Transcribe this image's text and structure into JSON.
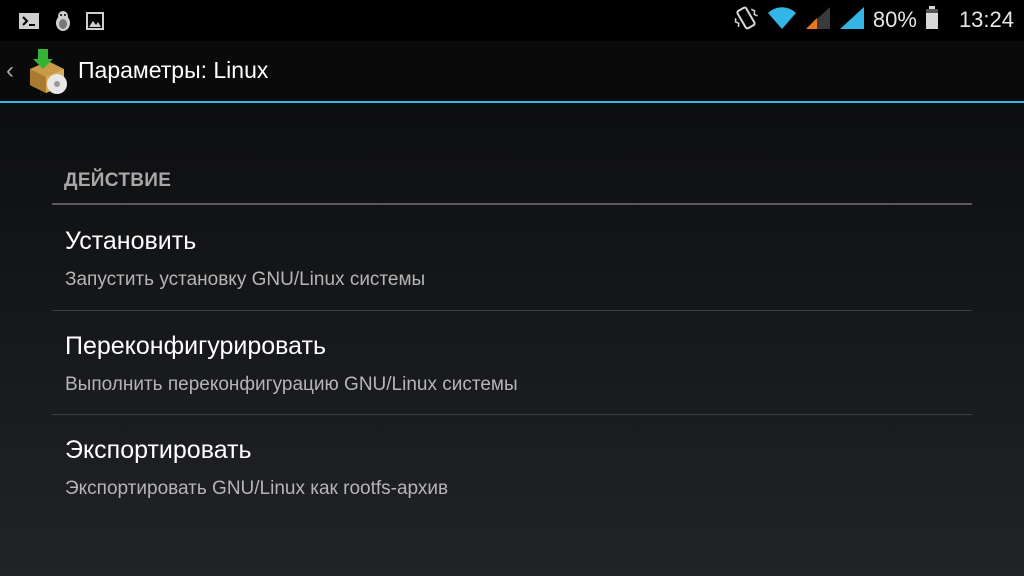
{
  "status_bar": {
    "battery_percent": "80%",
    "time": "13:24",
    "icons_left": [
      "terminal-icon",
      "linux-penguin-icon",
      "image-icon"
    ],
    "icons_right": [
      "vibrate-icon",
      "wifi-icon",
      "signal-sim1-icon",
      "signal-sim2-icon",
      "battery-icon"
    ]
  },
  "action_bar": {
    "title": "Параметры: Linux"
  },
  "section": {
    "header": "ДЕЙСТВИЕ"
  },
  "preferences": [
    {
      "title": "Установить",
      "summary": "Запустить установку GNU/Linux системы"
    },
    {
      "title": "Переконфигурировать",
      "summary": "Выполнить переконфигурацию GNU/Linux системы"
    },
    {
      "title": "Экспортировать",
      "summary": "Экспортировать GNU/Linux как rootfs-архив"
    }
  ],
  "colors": {
    "accent": "#33b5e5",
    "wifi": "#33b5e5",
    "signal_sim1": "#e8781e",
    "signal_sim2": "#33b5e5"
  }
}
